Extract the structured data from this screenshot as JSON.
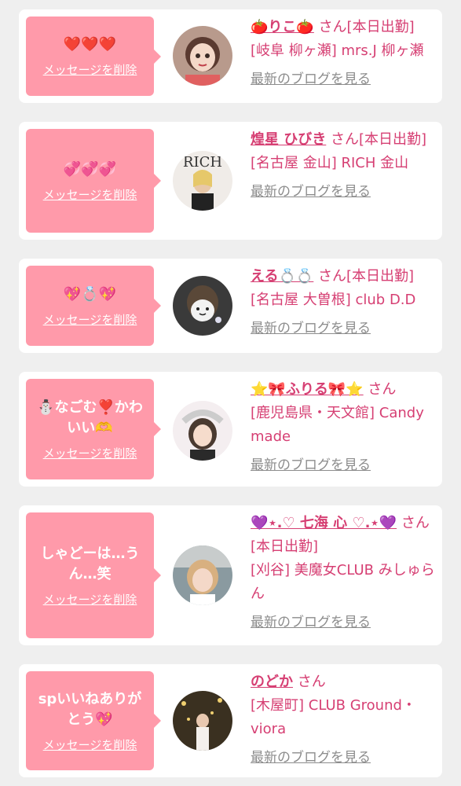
{
  "accent": "#d63f73",
  "bubble_color": "#ff9aaa",
  "cards": [
    {
      "message": "❤️❤️❤️",
      "delete_label": "メッセージを削除",
      "name": "🍅りこ🍅",
      "suffix": "さん[本日出勤]",
      "shop": "[岐阜 柳ヶ瀬] mrs.J 柳ヶ瀬",
      "blog_label": "最新のブログを見る",
      "avatar": "anime-girl-avatar"
    },
    {
      "message": "💞💞💞",
      "delete_label": "メッセージを削除",
      "name": "煌星 ひびき",
      "suffix": "さん[本日出勤]",
      "shop": "[名古屋 金山] RICH 金山",
      "blog_label": "最新のブログを見る",
      "avatar": "rich-magazine-avatar"
    },
    {
      "message": "💖💍💖",
      "delete_label": "メッセージを削除",
      "name": "える💍💍",
      "suffix": "さん[本日出勤]",
      "shop": "[名古屋 大曽根] club D.D",
      "blog_label": "最新のブログを見る",
      "avatar": "cat-filter-avatar"
    },
    {
      "message": "⛄なごむ❣️かわいい🫶",
      "delete_label": "メッセージを削除",
      "name": "⭐🎀ふりる🎀⭐",
      "suffix": "さん",
      "shop": "[鹿児島県・天文館] Candy made",
      "blog_label": "最新のブログを見る",
      "avatar": "lace-headband-avatar"
    },
    {
      "message": "しゃどーは…うん…笑",
      "delete_label": "メッセージを削除",
      "name": "💜⋆.♡ 七海 心 ♡.⋆💜",
      "suffix": "さん[本日出勤]",
      "shop": "[刈谷] 美魔女CLUB みしゅらん",
      "blog_label": "最新のブログを見る",
      "avatar": "blonde-woman-avatar"
    },
    {
      "message": "spいいねありがとう💖",
      "delete_label": "メッセージを削除",
      "name": "のどか",
      "suffix": "さん",
      "shop": "[木屋町] CLUB Ground・viora",
      "blog_label": "最新のブログを見る",
      "avatar": "gold-lights-avatar"
    }
  ]
}
